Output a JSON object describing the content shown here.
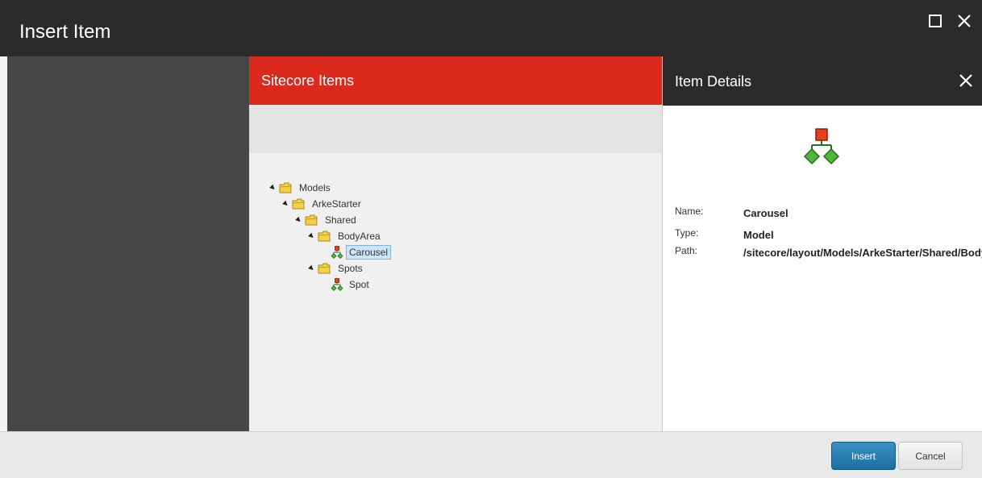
{
  "dialog": {
    "title": "Insert Item"
  },
  "center": {
    "header": "Sitecore Items",
    "tree": [
      {
        "label": "Models"
      },
      {
        "label": "ArkeStarter"
      },
      {
        "label": "Shared"
      },
      {
        "label": "BodyArea"
      },
      {
        "label": "Carousel"
      },
      {
        "label": "Spots"
      },
      {
        "label": "Spot"
      }
    ]
  },
  "details": {
    "header": "Item Details",
    "name_label": "Name:",
    "name_value": "Carousel",
    "type_label": "Type:",
    "type_value": "Model",
    "path_label": "Path:",
    "path_value": "/sitecore/layout/Models/ArkeStarter/Shared/BodyArea/Carousel"
  },
  "footer": {
    "insert_label": "Insert",
    "cancel_label": "Cancel"
  },
  "colors": {
    "titlebar": "#2b2b2b",
    "accent_red": "#dc291e",
    "left_pane": "#474747",
    "insert_button": "#2a7fb4"
  }
}
